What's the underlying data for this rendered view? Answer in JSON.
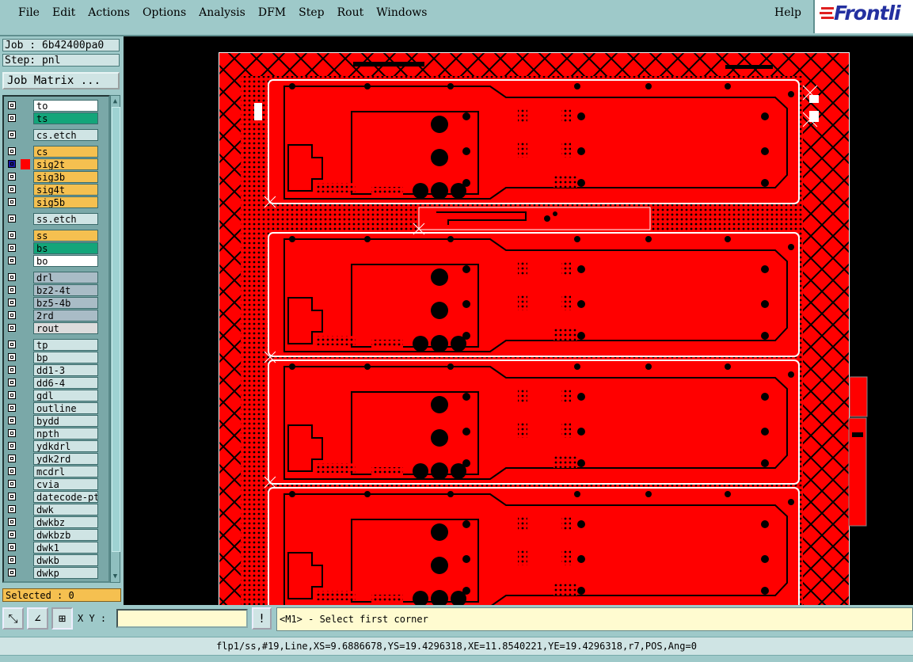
{
  "menu": [
    "File",
    "Edit",
    "Actions",
    "Options",
    "Analysis",
    "DFM",
    "Step",
    "Rout",
    "Windows"
  ],
  "help": "Help",
  "logo": "Frontli",
  "job": "Job : 6b42400pa0",
  "step": "Step: pnl",
  "job_matrix": "Job Matrix ...",
  "layers": [
    {
      "name": "to",
      "color": "#ffffff"
    },
    {
      "name": "ts",
      "color": "#13a57a"
    },
    {
      "name": "cs.etch",
      "color": "#cfe4e4"
    },
    {
      "name": "cs",
      "color": "#f5c050"
    },
    {
      "name": "sig2t",
      "color": "#f5c050",
      "active": true
    },
    {
      "name": "sig3b",
      "color": "#f5c050"
    },
    {
      "name": "sig4t",
      "color": "#f5c050"
    },
    {
      "name": "sig5b",
      "color": "#f5c050"
    },
    {
      "name": "ss.etch",
      "color": "#cfe4e4"
    },
    {
      "name": "ss",
      "color": "#f5c050"
    },
    {
      "name": "bs",
      "color": "#13a57a"
    },
    {
      "name": "bo",
      "color": "#ffffff"
    },
    {
      "name": "drl",
      "color": "#a9bcc6"
    },
    {
      "name": "bz2-4t",
      "color": "#a9bcc6"
    },
    {
      "name": "bz5-4b",
      "color": "#a9bcc6"
    },
    {
      "name": "2rd",
      "color": "#a9bcc6"
    },
    {
      "name": "rout",
      "color": "#dcdcdc"
    },
    {
      "name": "tp",
      "color": "#cfe4e4"
    },
    {
      "name": "bp",
      "color": "#cfe4e4"
    },
    {
      "name": "dd1-3",
      "color": "#cfe4e4"
    },
    {
      "name": "dd6-4",
      "color": "#cfe4e4"
    },
    {
      "name": "gdl",
      "color": "#cfe4e4"
    },
    {
      "name": "outline",
      "color": "#cfe4e4"
    },
    {
      "name": "bydd",
      "color": "#cfe4e4"
    },
    {
      "name": "npth",
      "color": "#cfe4e4"
    },
    {
      "name": "ydkdrl",
      "color": "#cfe4e4"
    },
    {
      "name": "ydk2rd",
      "color": "#cfe4e4"
    },
    {
      "name": "mcdrl",
      "color": "#cfe4e4"
    },
    {
      "name": "cvia",
      "color": "#cfe4e4"
    },
    {
      "name": "datecode-pte",
      "color": "#cfe4e4"
    },
    {
      "name": "dwk",
      "color": "#cfe4e4"
    },
    {
      "name": "dwkbz",
      "color": "#cfe4e4"
    },
    {
      "name": "dwkbzb",
      "color": "#cfe4e4"
    },
    {
      "name": "dwk1",
      "color": "#cfe4e4"
    },
    {
      "name": "dwkb",
      "color": "#cfe4e4"
    },
    {
      "name": "dwkp",
      "color": "#cfe4e4"
    }
  ],
  "selected": "Selected : 0",
  "xy_label": "X Y :",
  "xy_value": "",
  "message": "<M1> - Select first corner",
  "status": "flp1/ss,#19,Line,XS=9.6886678,YS=19.4296318,XE=11.8540221,YE=19.4296318,r7,POS,Ang=0",
  "colors": {
    "copper": "#ff0000",
    "panel_bg": "#9ec9c9",
    "sig_active": "#ff0000"
  }
}
